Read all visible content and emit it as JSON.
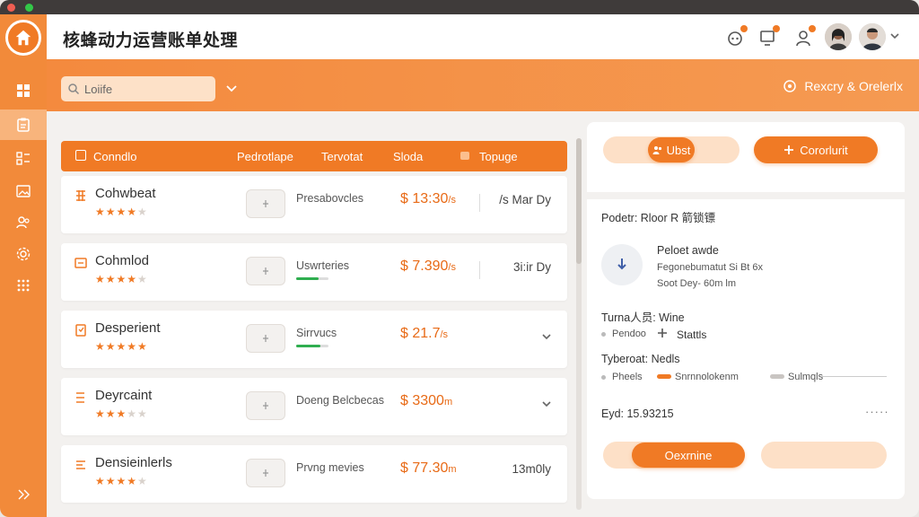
{
  "app": {
    "title": "核蜂动力运营账单处理"
  },
  "colors": {
    "accent": "#f07a25",
    "accent_light": "#fde0c7",
    "success": "#2fae4f"
  },
  "sidebar": {
    "items": [
      {
        "icon": "grid-icon"
      },
      {
        "icon": "clipboard-icon"
      },
      {
        "icon": "list-icon"
      },
      {
        "icon": "image-icon"
      },
      {
        "icon": "users-icon"
      },
      {
        "icon": "gear-icon"
      },
      {
        "icon": "apps-icon"
      }
    ],
    "bottom_icon": "collapse-icon"
  },
  "search": {
    "value": "Loiife"
  },
  "toolbar": {
    "right_label": "Rexcry & Orelerlx"
  },
  "table": {
    "headers": [
      "Conndlo",
      "Pedrotlape",
      "Tervotat",
      "Sloda",
      "Topuge"
    ],
    "rows": [
      {
        "name": "Cohwbeat",
        "rating": 4,
        "desc": "Presabovcles",
        "price": "$ 13:30",
        "unit": "/s",
        "date": "/s Mar Dy",
        "progress": null
      },
      {
        "name": "Cohmlod",
        "rating": 4,
        "desc": "Uswrteries",
        "price": "$ 7.390",
        "unit": "/s",
        "date": "3i:ir Dy",
        "progress": 0.7
      },
      {
        "name": "Desperient",
        "rating": 5,
        "desc": "Sirrvucs",
        "price": "$ 21.7",
        "unit": "/s",
        "date": "",
        "progress": 0.75
      },
      {
        "name": "Deyrcaint",
        "rating": 3,
        "desc": "Doeng Belcbecas",
        "price": "$ 3300",
        "unit": "m",
        "date": "",
        "progress": null
      },
      {
        "name": "Densieinlerls",
        "rating": 4,
        "desc": "Prvng mevies",
        "price": "$ 77.30",
        "unit": "m",
        "date": "13m0ly",
        "progress": null
      }
    ]
  },
  "panel": {
    "btn_left": "Ubst",
    "btn_right": "Cororlurit",
    "heading": "Podetr:  Rloor R 箭锁镖",
    "detail_title": "Peloet awde",
    "detail_line1": "Fegonebumatut Si Bt 6x",
    "detail_line2": "Soot Dey- 60m lm",
    "type_label": "Turna人员:  Wine",
    "pendoo": "Pendoo",
    "status": "Stattls",
    "tybrood": "Tyberoat:  Nedls",
    "pheals": "Pheels",
    "legend_a": "Snrnnolokenm",
    "legend_b": "Sulmqls",
    "eyed": "Eyd:  15.93215",
    "more": "·····",
    "bottom_center": "Oexrnine"
  }
}
